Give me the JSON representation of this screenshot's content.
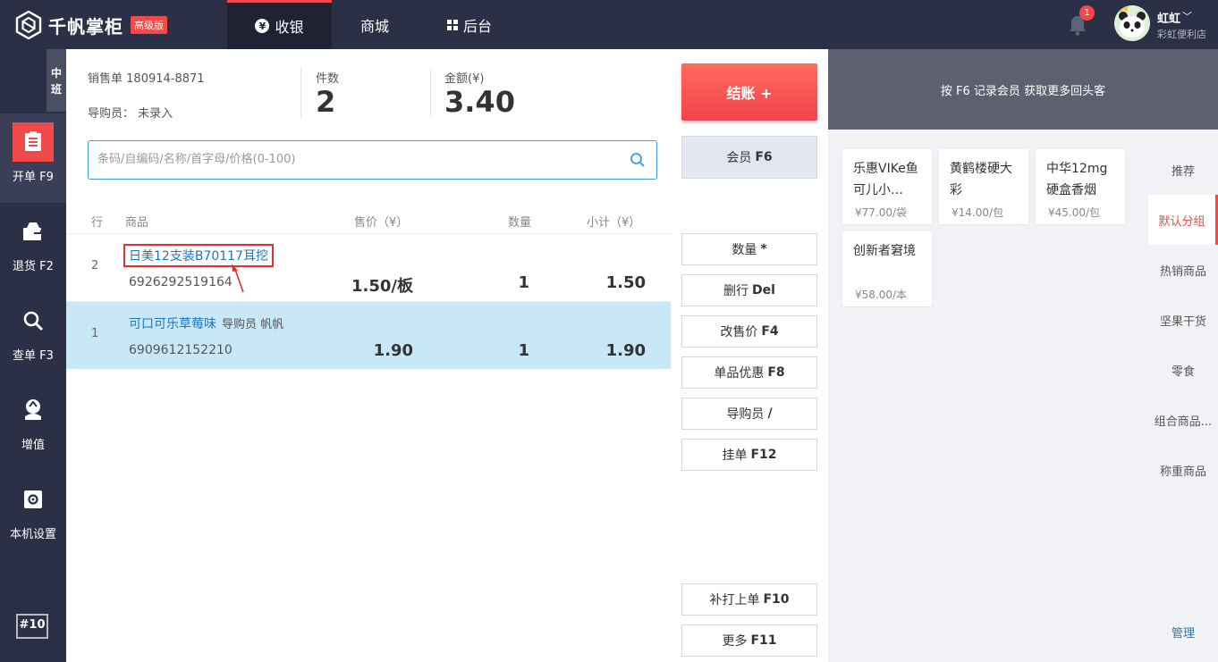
{
  "app": {
    "logo_text": "千帆掌柜",
    "edition_badge": "高级版"
  },
  "nav": {
    "tabs": [
      {
        "label": "收银",
        "icon": "yen-circle-icon",
        "active": true
      },
      {
        "label": "商城",
        "active": false
      },
      {
        "label": "后台",
        "icon": "grid-icon",
        "active": false
      }
    ]
  },
  "header": {
    "notification_count": "1",
    "user_name": "虹虹",
    "store_name": "彩虹便利店"
  },
  "sidebar": {
    "shift_label": "中班",
    "items": [
      {
        "label": "开单 F9",
        "icon": "order-icon",
        "active": true
      },
      {
        "label": "退货 F2",
        "icon": "return-icon",
        "active": false
      },
      {
        "label": "查单 F3",
        "icon": "search-icon",
        "active": false
      },
      {
        "label": "增值",
        "icon": "value-added-icon",
        "active": false
      },
      {
        "label": "本机设置",
        "icon": "settings-icon",
        "active": false
      }
    ],
    "device_label": "#10"
  },
  "order": {
    "sale_no_label": "销售单",
    "sale_no": "180914-8871",
    "guide_label": "导购员：",
    "guide_value": "未录入",
    "count_label": "件数",
    "count_value": "2",
    "amount_label": "金额(¥)",
    "amount_value": "3.40"
  },
  "search": {
    "placeholder": "条码/自编码/名称/首字母/价格(0-100)"
  },
  "table": {
    "headers": {
      "idx": "行",
      "name": "商品",
      "price": "售价（¥）",
      "qty": "数量",
      "subtotal": "小计（¥）"
    },
    "rows": [
      {
        "idx": "2",
        "name": "日美12支装B70117耳挖",
        "guide": "",
        "code": "6926292519164",
        "price": "1.50/板",
        "qty": "1",
        "subtotal": "1.50",
        "selected": false,
        "highlighted": true
      },
      {
        "idx": "1",
        "name": "可口可乐草莓味",
        "guide": "导购员 帆帆",
        "code": "6909612152210",
        "price": "1.90",
        "qty": "1",
        "subtotal": "1.90",
        "selected": true,
        "highlighted": false
      }
    ]
  },
  "actions": {
    "checkout": "结账 +",
    "member": {
      "label": "会员",
      "key": "F6"
    },
    "buttons": [
      {
        "label": "数量",
        "key": "*"
      },
      {
        "label": "删行",
        "key": "Del"
      },
      {
        "label": "改售价",
        "key": "F4"
      },
      {
        "label": "单品优惠",
        "key": "F8"
      },
      {
        "label": "导购员",
        "key": "/"
      },
      {
        "label": "挂单",
        "key": "F12"
      }
    ],
    "bottom_buttons": [
      {
        "label": "补打上单",
        "key": "F10"
      },
      {
        "label": "更多",
        "key": "F11"
      }
    ]
  },
  "right": {
    "promo": "按 F6 记录会员 获取更多回头客",
    "goods": [
      {
        "name": "乐惠VIKe鱼可儿小…",
        "price": "¥77.00/袋"
      },
      {
        "name": "黄鹤楼硬大彩",
        "price": "¥14.00/包"
      },
      {
        "name": "中华12mg硬盒香烟",
        "price": "¥45.00/包"
      },
      {
        "name": "创新者窘境",
        "price": "¥58.00/本"
      }
    ],
    "categories": [
      "推荐",
      "默认分组",
      "热销商品",
      "坚果干货",
      "零食",
      "组合商品...",
      "称重商品"
    ],
    "active_category": "默认分组",
    "manage_label": "管理"
  },
  "colors": {
    "topbar": "#2b3046",
    "accent_red": "#f04a4a",
    "link_blue": "#1a78c2",
    "selected_row": "#c8e7f7"
  }
}
